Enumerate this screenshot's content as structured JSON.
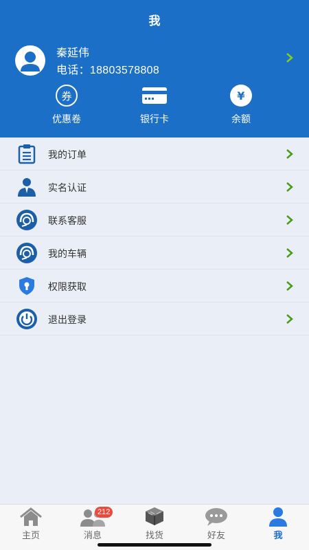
{
  "header": {
    "title": "我"
  },
  "profile": {
    "name": "秦延伟",
    "phone": "电话：18803578808"
  },
  "shortcuts": [
    {
      "label": "优惠卷",
      "icon": "coupon-icon",
      "glyph": "券"
    },
    {
      "label": "银行卡",
      "icon": "bank-card-icon"
    },
    {
      "label": "余额",
      "icon": "balance-icon",
      "glyph": "¥"
    }
  ],
  "menu": [
    {
      "label": "我的订单",
      "icon": "clipboard-icon"
    },
    {
      "label": "实名认证",
      "icon": "person-icon"
    },
    {
      "label": "联系客服",
      "icon": "headset-icon"
    },
    {
      "label": "我的车辆",
      "icon": "headset-icon"
    },
    {
      "label": "权限获取",
      "icon": "shield-lock-icon"
    },
    {
      "label": "退出登录",
      "icon": "power-icon"
    }
  ],
  "tabs": [
    {
      "label": "主页",
      "icon": "home-icon"
    },
    {
      "label": "消息",
      "icon": "contacts-icon",
      "badge": "212"
    },
    {
      "label": "找货",
      "icon": "box-icon"
    },
    {
      "label": "好友",
      "icon": "chat-icon"
    },
    {
      "label": "我",
      "icon": "user-icon",
      "active": true
    }
  ],
  "colors": {
    "primary": "#1b6fc6",
    "background": "#eaeef6",
    "chevron": "#4a9a1a",
    "badge": "#e74c3c"
  }
}
